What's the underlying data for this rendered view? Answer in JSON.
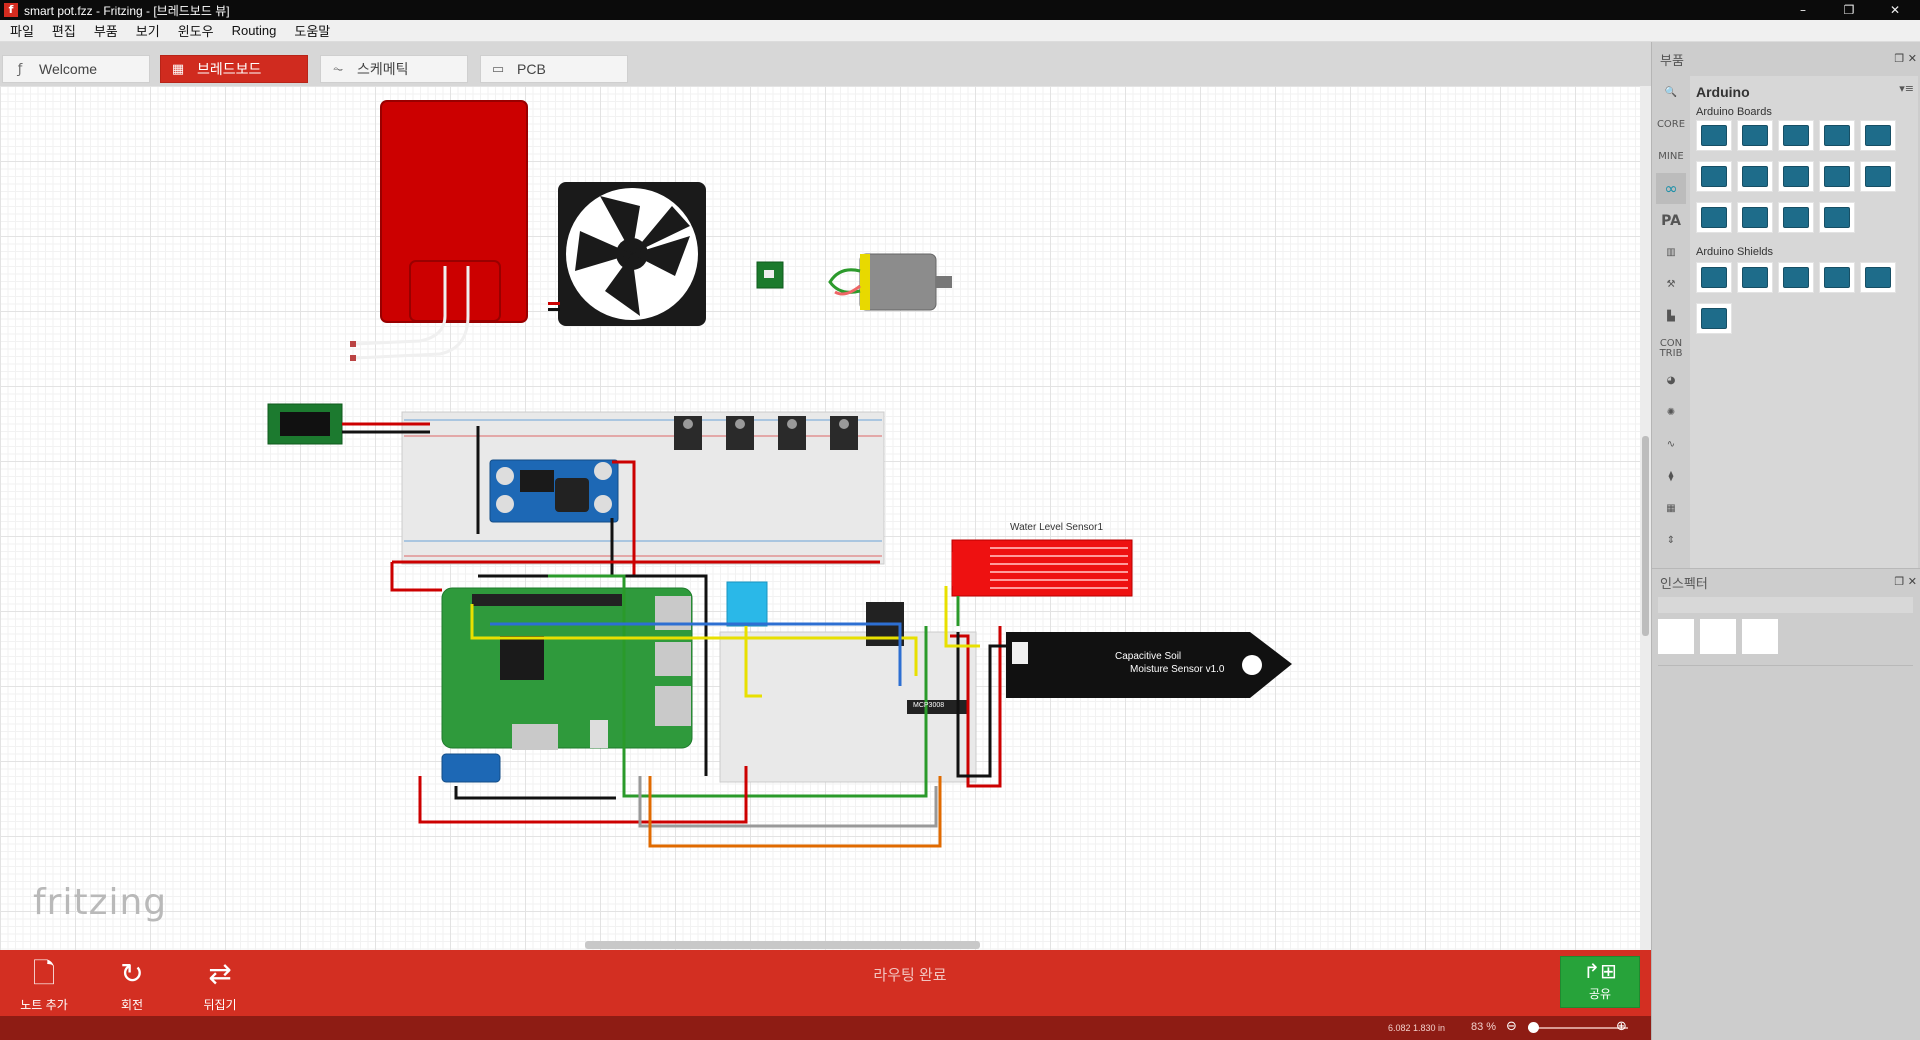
{
  "window": {
    "title": "smart pot.fzz - Fritzing - [브레드보드 뷰]",
    "app_icon": "f",
    "controls": [
      "–",
      "❐",
      "✕"
    ]
  },
  "menu": [
    "파일",
    "편집",
    "부품",
    "보기",
    "윈도우",
    "Routing",
    "도움말"
  ],
  "tabs": [
    {
      "label": "Welcome",
      "icon": "fritzing-icon"
    },
    {
      "label": "브레드보드",
      "icon": "breadboard-icon"
    },
    {
      "label": "스케메틱",
      "icon": "schematic-icon"
    },
    {
      "label": "PCB",
      "icon": "pcb-icon"
    }
  ],
  "canvas": {
    "watermark": "fritzing",
    "labels": {
      "water_sensor": "Water Level Sensor1",
      "soil_sensor_line1": "Capacitive Soil",
      "soil_sensor_line2": "Moisture Sensor v1.0",
      "chip": "MCP3008"
    }
  },
  "bottom_toolbar": {
    "add_note": "노트 추가",
    "rotate": "회전",
    "flip": "뒤집기",
    "routing_status": "라우팅 완료",
    "share": "공유"
  },
  "statusbar": {
    "coords": "6.082 1.830 in",
    "zoom": "83 %"
  },
  "parts_panel": {
    "header": "부품",
    "bin_title": "Arduino",
    "bin_tabs": [
      "CORE",
      "MINE"
    ],
    "contrib": "CON TRIB",
    "boards_section": "Arduino Boards",
    "shields_section": "Arduino Shields"
  },
  "inspector": {
    "header": "인스펙터"
  },
  "colors": {
    "accent": "#d32f22",
    "share": "#27a33a",
    "statusbar": "#8e1c14"
  }
}
